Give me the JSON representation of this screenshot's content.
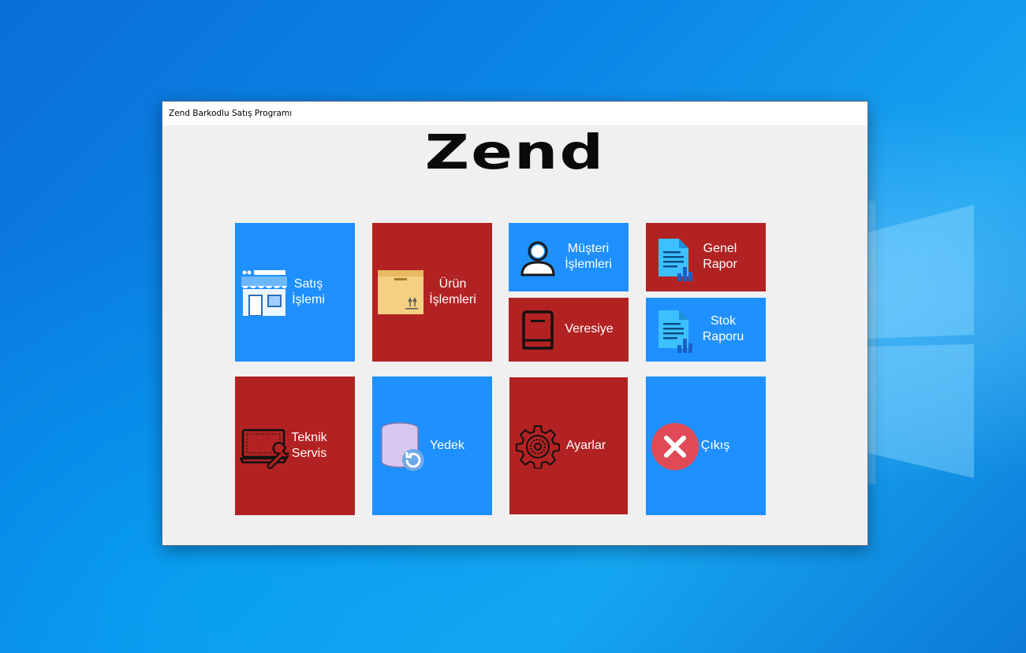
{
  "window": {
    "title": "Zend Barkodlu Satış Programı"
  },
  "logo": {
    "text": "Zend"
  },
  "colors": {
    "blue": "#1e90ff",
    "red": "#b22222"
  },
  "tiles": {
    "satis": {
      "line1": "Satış",
      "line2": "İşlemi",
      "icon": "store-icon"
    },
    "urun": {
      "line1": "Ürün",
      "line2": "İşlemleri",
      "icon": "box-icon"
    },
    "musteri": {
      "line1": "Müşteri",
      "line2": "İşlemleri",
      "icon": "user-icon"
    },
    "genel": {
      "line1": "Genel",
      "line2": "Rapor",
      "icon": "report-icon"
    },
    "veresiye": {
      "label": "Veresiye",
      "icon": "book-icon"
    },
    "stok": {
      "line1": "Stok",
      "line2": "Raporu",
      "icon": "report-icon"
    },
    "teknik": {
      "line1": "Teknik",
      "line2": "Servis",
      "icon": "laptop-wrench-icon"
    },
    "yedek": {
      "label": "Yedek",
      "icon": "database-backup-icon"
    },
    "ayarlar": {
      "label": "Ayarlar",
      "icon": "gear-icon"
    },
    "cikis": {
      "label": "Çıkış",
      "icon": "close-icon"
    }
  }
}
